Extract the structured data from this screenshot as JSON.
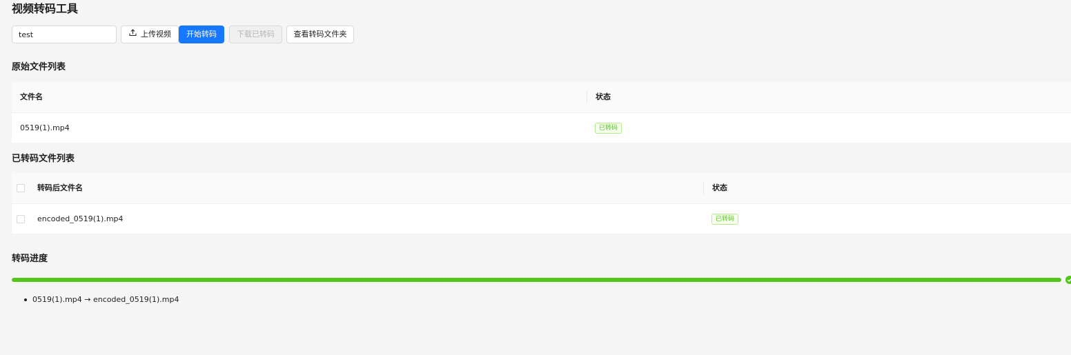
{
  "app": {
    "title": "视频转码工具"
  },
  "toolbar": {
    "name_input_value": "test",
    "upload_label": "上传视频",
    "start_label": "开始转码",
    "download_label": "下载已转码",
    "open_folder_label": "查看转码文件夹"
  },
  "original_files": {
    "title": "原始文件列表",
    "columns": [
      "文件名",
      "状态"
    ],
    "rows": [
      {
        "filename": "0519(1).mp4",
        "status": "已转码"
      }
    ]
  },
  "encoded_files": {
    "title": "已转码文件列表",
    "columns": [
      "转码后文件名",
      "状态"
    ],
    "rows": [
      {
        "filename": "encoded_0519(1).mp4",
        "status": "已转码",
        "checked": false
      }
    ]
  },
  "progress": {
    "title": "转码进度",
    "percent": 100,
    "status": "success",
    "logs": [
      "0519(1).mp4 → encoded_0519(1).mp4"
    ]
  },
  "colors": {
    "primary": "#1677ff",
    "success": "#52c41a",
    "page_background": "#f5f5f5"
  },
  "icons": {
    "upload": "upload-icon",
    "progress_done": "check-circle-icon"
  }
}
